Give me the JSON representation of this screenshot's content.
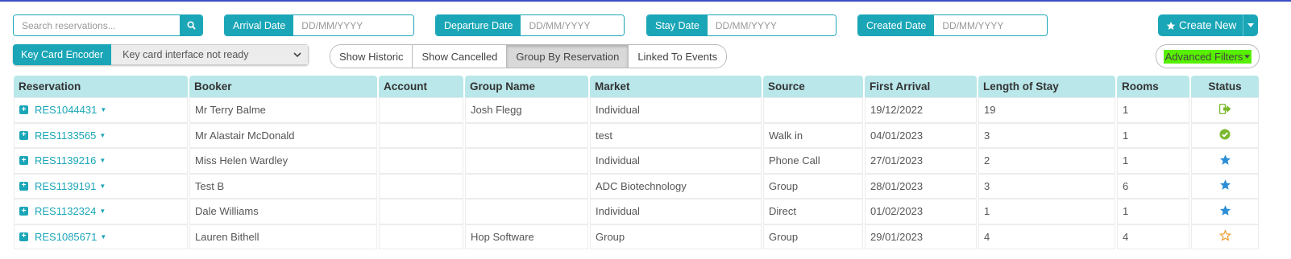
{
  "search": {
    "placeholder": "Search reservations..."
  },
  "date_filters": [
    {
      "label": "Arrival Date",
      "placeholder": "DD/MM/YYYY"
    },
    {
      "label": "Departure Date",
      "placeholder": "DD/MM/YYYY"
    },
    {
      "label": "Stay Date",
      "placeholder": "DD/MM/YYYY"
    },
    {
      "label": "Created Date",
      "placeholder": "DD/MM/YYYY"
    }
  ],
  "create_new": {
    "label": "Create New"
  },
  "key_card": {
    "label": "Key Card Encoder",
    "value": "Key card interface not ready"
  },
  "toggles": [
    "Show Historic",
    "Show Cancelled",
    "Group By Reservation",
    "Linked To Events"
  ],
  "advanced_filters": {
    "label": "Advanced Filters"
  },
  "colors": {
    "accent": "#1aa6b7",
    "header_bg": "#b9e7ea",
    "highlight": "#57f000",
    "status_green": "#7cb82f",
    "status_blue": "#2c8fd6",
    "status_orange": "#f0a030"
  },
  "table": {
    "columns": [
      "Reservation",
      "Booker",
      "Account",
      "Group Name",
      "Market",
      "Source",
      "First Arrival",
      "Length of Stay",
      "Rooms",
      "Status"
    ],
    "rows": [
      {
        "reservation": "RES1044431",
        "booker": "Mr Terry Balme",
        "account": "",
        "group_name": "Josh Flegg",
        "market": "Individual",
        "source": "",
        "first_arrival": "19/12/2022",
        "length_of_stay": "19",
        "rooms": "1",
        "status_icon": "checked-out-icon"
      },
      {
        "reservation": "RES1133565",
        "booker": "Mr Alastair McDonald",
        "account": "",
        "group_name": "",
        "market": "test",
        "source": "Walk in",
        "first_arrival": "04/01/2023",
        "length_of_stay": "3",
        "rooms": "1",
        "status_icon": "checked-in-icon"
      },
      {
        "reservation": "RES1139216",
        "booker": "Miss Helen Wardley",
        "account": "",
        "group_name": "",
        "market": "Individual",
        "source": "Phone Call",
        "first_arrival": "27/01/2023",
        "length_of_stay": "2",
        "rooms": "1",
        "status_icon": "star-filled-icon"
      },
      {
        "reservation": "RES1139191",
        "booker": "Test B",
        "account": "",
        "group_name": "",
        "market": "ADC Biotechnology",
        "source": "Group",
        "first_arrival": "28/01/2023",
        "length_of_stay": "3",
        "rooms": "6",
        "status_icon": "star-filled-icon"
      },
      {
        "reservation": "RES1132324",
        "booker": "Dale Williams",
        "account": "",
        "group_name": "",
        "market": "Individual",
        "source": "Direct",
        "first_arrival": "01/02/2023",
        "length_of_stay": "1",
        "rooms": "1",
        "status_icon": "star-filled-icon"
      },
      {
        "reservation": "RES1085671",
        "booker": "Lauren Bithell",
        "account": "",
        "group_name": "Hop Software",
        "market": "Group",
        "source": "Group",
        "first_arrival": "29/01/2023",
        "length_of_stay": "4",
        "rooms": "4",
        "status_icon": "star-outline-icon"
      }
    ]
  }
}
